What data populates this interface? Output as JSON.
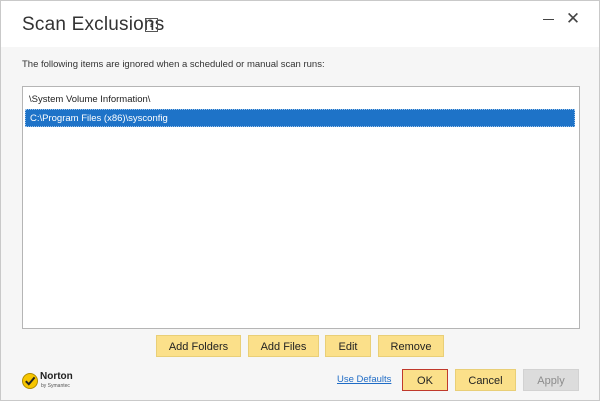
{
  "window": {
    "title": "Scan Exclusions",
    "help_glyph": "?",
    "minimize_icon": "minimize-icon",
    "close_glyph": "✕"
  },
  "description": "The following items are ignored when a scheduled or manual scan runs:",
  "list": {
    "items": [
      {
        "label": "\\System Volume Information\\",
        "selected": false
      },
      {
        "label": "C:\\Program Files (x86)\\sysconfig",
        "selected": true
      }
    ]
  },
  "actions": {
    "add_folders": "Add Folders",
    "add_files": "Add Files",
    "edit": "Edit",
    "remove": "Remove"
  },
  "footer": {
    "use_defaults": "Use Defaults",
    "ok": "OK",
    "cancel": "Cancel",
    "apply": "Apply",
    "logo_text": "Norton",
    "logo_sub": "by Symantec"
  },
  "colors": {
    "selection": "#1e73c8",
    "button": "#fbe08a",
    "link": "#1f6cc6",
    "ok_border": "#c0392b"
  }
}
